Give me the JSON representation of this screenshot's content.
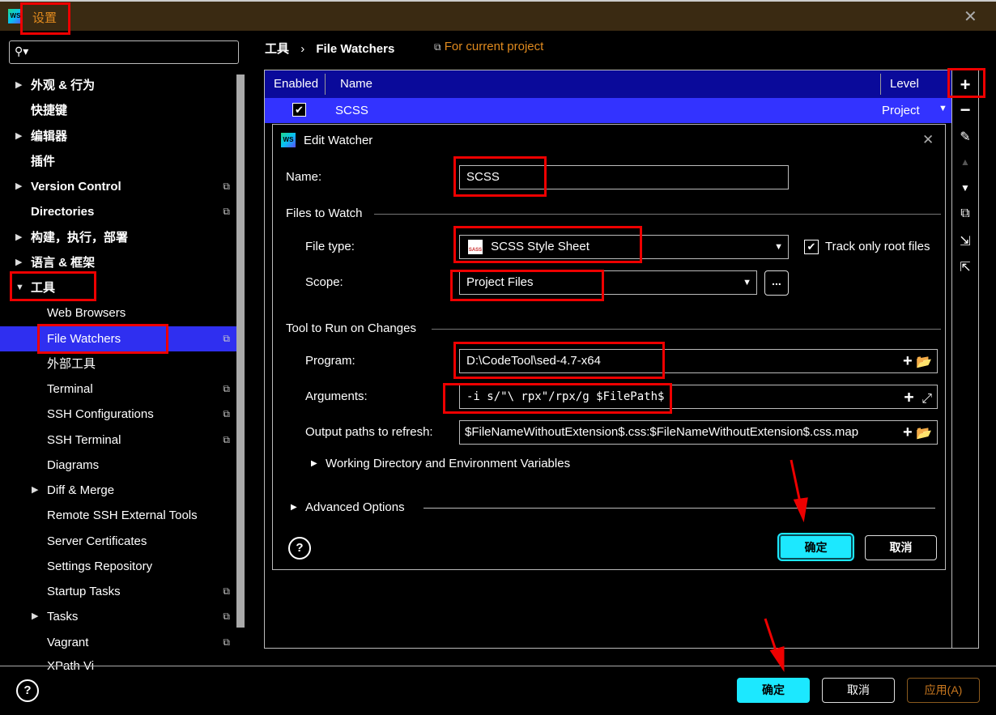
{
  "window": {
    "title": "设置",
    "logo": "WS"
  },
  "search": {
    "placeholder": ""
  },
  "sidebar": {
    "items": [
      {
        "label": "外观 & 行为",
        "expander": "collapsed",
        "bold": true
      },
      {
        "label": "快捷键",
        "bold": true
      },
      {
        "label": "编辑器",
        "expander": "collapsed",
        "bold": true
      },
      {
        "label": "插件",
        "bold": true
      },
      {
        "label": "Version Control",
        "expander": "collapsed",
        "bold": true,
        "project_icon": true
      },
      {
        "label": "Directories",
        "bold": true,
        "project_icon": true
      },
      {
        "label": "构建，执行，部署",
        "expander": "collapsed",
        "bold": true
      },
      {
        "label": "语言 & 框架",
        "expander": "collapsed",
        "bold": true
      },
      {
        "label": "工具",
        "expander": "expanded",
        "bold": true
      },
      {
        "label": "Web Browsers",
        "child": true
      },
      {
        "label": "File Watchers",
        "child": true,
        "selected": true,
        "project_icon": true
      },
      {
        "label": "外部工具",
        "child": true
      },
      {
        "label": "Terminal",
        "child": true,
        "project_icon": true
      },
      {
        "label": "SSH Configurations",
        "child": true,
        "project_icon": true
      },
      {
        "label": "SSH Terminal",
        "child": true,
        "project_icon": true
      },
      {
        "label": "Diagrams",
        "child": true
      },
      {
        "label": "Diff & Merge",
        "child": true,
        "expander": "collapsed"
      },
      {
        "label": "Remote SSH External Tools",
        "child": true
      },
      {
        "label": "Server Certificates",
        "child": true
      },
      {
        "label": "Settings Repository",
        "child": true
      },
      {
        "label": "Startup Tasks",
        "child": true,
        "project_icon": true
      },
      {
        "label": "Tasks",
        "child": true,
        "expander": "collapsed",
        "project_icon": true
      },
      {
        "label": "Vagrant",
        "child": true,
        "project_icon": true
      },
      {
        "label": "XPath Vi",
        "child": true
      }
    ]
  },
  "breadcrumb": {
    "parent": "工具",
    "current": "File Watchers",
    "scope": "For current project"
  },
  "table": {
    "headers": {
      "enabled": "Enabled",
      "name": "Name",
      "level": "Level"
    },
    "rows": [
      {
        "enabled": true,
        "name": "SCSS",
        "level": "Project"
      }
    ]
  },
  "toolbar": {
    "icons": [
      "plus-icon",
      "minus-icon",
      "edit-icon",
      "move-up-icon",
      "move-down-icon",
      "copy-icon",
      "import-icon",
      "export-icon"
    ]
  },
  "dialog": {
    "title": "Edit Watcher",
    "name_label": "Name:",
    "name_value": "SCSS",
    "files_section": "Files to Watch",
    "file_type_label": "File type:",
    "file_type_value": "SCSS Style Sheet",
    "file_type_icon_text": "SASS",
    "track_root_label": "Track only root files",
    "track_root_checked": true,
    "scope_label": "Scope:",
    "scope_value": "Project Files",
    "scope_more": "...",
    "tool_section": "Tool to Run on Changes",
    "program_label": "Program:",
    "program_value": "D:\\CodeTool\\sed-4.7-x64",
    "arguments_label": "Arguments:",
    "arguments_value": "-i s/\"\\ rpx\"/rpx/g $FilePath$",
    "output_label": "Output paths to refresh:",
    "output_value": "$FileNameWithoutExtension$.css:$FileNameWithoutExtension$.css.map",
    "working_dir": "Working Directory and Environment Variables",
    "advanced": "Advanced Options",
    "ok": "确定",
    "cancel": "取消",
    "help": "?"
  },
  "footer": {
    "ok": "确定",
    "cancel": "取消",
    "apply": "应用(A)",
    "help": "?"
  },
  "colors": {
    "accent_cyan": "#1ce8ff",
    "selection": "#3333ff",
    "header": "#0a0a9a",
    "title_orange": "#e08a1e",
    "annotation": "#ee0000"
  }
}
